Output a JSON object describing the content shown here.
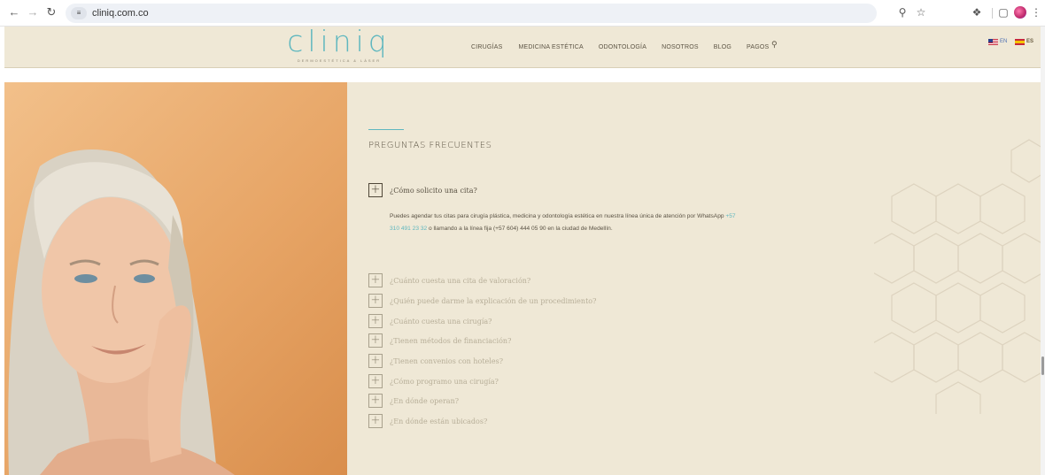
{
  "browser": {
    "url": "cliniq.com.co",
    "back_icon": "arrow-left-icon",
    "forward_icon": "arrow-right-icon",
    "reload_icon": "reload-icon",
    "site_info_icon": "tune-icon"
  },
  "header": {
    "logo_text": "cliniq",
    "logo_tagline": "DERMOESTÉTICA & LÁSER",
    "nav": [
      {
        "label": "CIRUGÍAS"
      },
      {
        "label": "MEDICINA ESTÉTICA"
      },
      {
        "label": "ODONTOLOGÍA"
      },
      {
        "label": "NOSOTROS"
      },
      {
        "label": "BLOG"
      },
      {
        "label": "PAGOS"
      }
    ],
    "lang": {
      "en": "EN",
      "es": "ES"
    }
  },
  "faq": {
    "title": "PREGUNTAS FRECUENTES",
    "items": [
      {
        "q": "¿Cómo solicito una cita?"
      },
      {
        "q": "¿Cuánto cuesta una cita de valoración?"
      },
      {
        "q": "¿Quién puede darme la explicación de un procedimiento?"
      },
      {
        "q": "¿Cuánto cuesta una cirugía?"
      },
      {
        "q": "¿Tienen métodos de financiación?"
      },
      {
        "q": "¿Tienen convenios con hoteles?"
      },
      {
        "q": "¿Cómo programo una cirugía?"
      },
      {
        "q": "¿En dónde operan?"
      },
      {
        "q": "¿En dónde están ubicados?"
      }
    ],
    "answer": {
      "part1": "Puedes agendar tus citas para cirugía plástica, medicina y odontología estética en nuestra línea única de atención por WhatsApp ",
      "phone": "+57 310 491 23 32",
      "part2": " o llamando a la línea fija (+57 604) 444 05 90 en la ciudad de Medellín."
    }
  },
  "colors": {
    "accent": "#5fb7bf",
    "panel": "#efe8d6",
    "hero": "#e7a566"
  }
}
